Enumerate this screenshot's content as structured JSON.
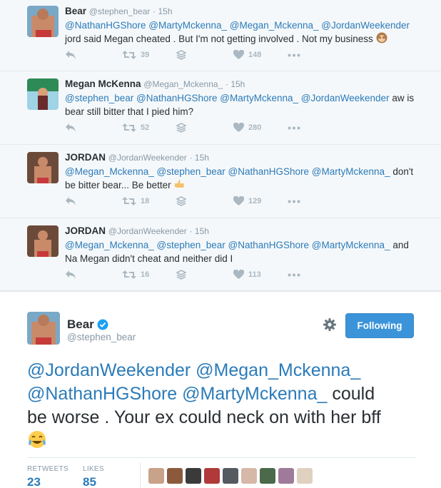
{
  "tweets": [
    {
      "name": "Bear",
      "handle": "@stephen_bear",
      "time": "· 15h",
      "mentions_line": "@NathanHGShore @MartyMckenna_ @Megan_Mckenna_ @JordanWeekender",
      "body": "jord said Megan cheated . But I'm not getting involved . Not my business",
      "retweets": "39",
      "likes": "148"
    },
    {
      "name": "Megan McKenna",
      "handle": "@Megan_Mckenna_",
      "time": "· 15h",
      "mentions_line": "@stephen_bear @NathanHGShore @MartyMckenna_ @JordanWeekender",
      "body_tail": " aw is",
      "body": "bear still bitter that I pied him?",
      "retweets": "52",
      "likes": "280"
    },
    {
      "name": "JORDAN",
      "handle": "@JordanWeekender",
      "time": "· 15h",
      "mentions_line": "@Megan_Mckenna_ @stephen_bear @NathanHGShore @MartyMckenna_",
      "body_tail": " don't",
      "body": "be bitter bear... Be better",
      "retweets": "18",
      "likes": "129"
    },
    {
      "name": "JORDAN",
      "handle": "@JordanWeekender",
      "time": "· 15h",
      "mentions_line": "@Megan_Mckenna_ @stephen_bear @NathanHGShore @MartyMckenna_",
      "body_tail": " and",
      "body": "Na Megan didn't cheat and neither did I",
      "retweets": "16",
      "likes": "113"
    }
  ],
  "main": {
    "name": "Bear",
    "handle": "@stephen_bear",
    "follow_label": "Following",
    "mention1": "@JordanWeekender",
    "mention2": "@Megan_Mckenna_",
    "mention3": "@NathanHGShore",
    "mention4": "@MartyMckenna_",
    "text1": " could",
    "text2": "be worse . Your ex could neck on with her bff",
    "retweets_label": "RETWEETS",
    "retweets": "23",
    "likes_label": "LIKES",
    "likes": "85"
  },
  "colors": {
    "accent": "#2b7bb9",
    "follow_button": "#3b94d9",
    "muted": "#8899a6"
  }
}
